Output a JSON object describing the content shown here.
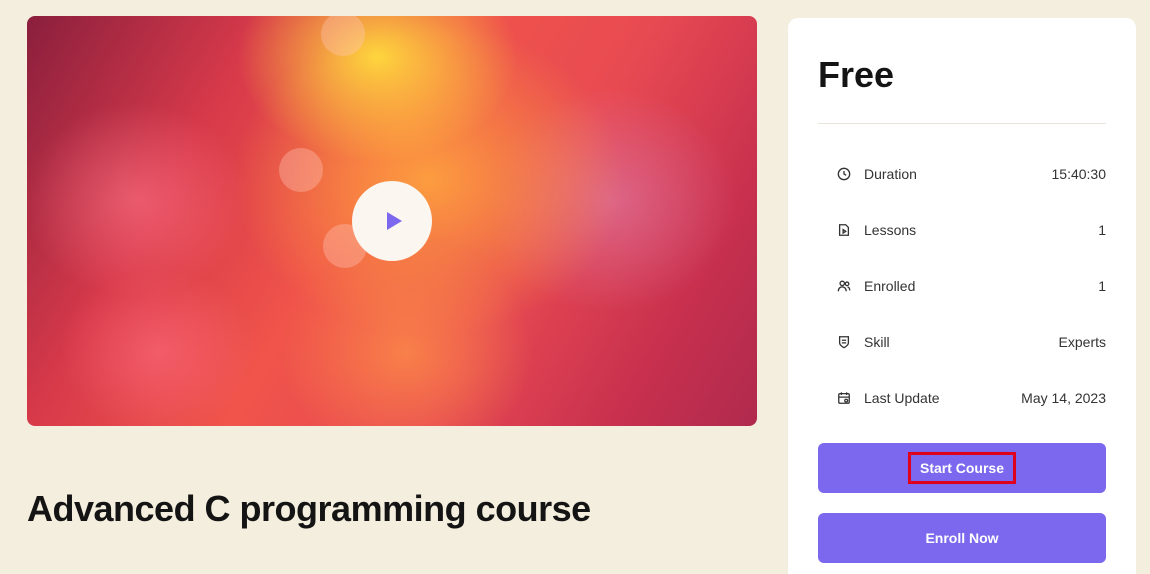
{
  "course": {
    "title": "Advanced C programming course"
  },
  "video": {
    "play_icon": "play-icon",
    "accent_color": "#7b68ee"
  },
  "sidebar": {
    "price": "Free",
    "info": [
      {
        "icon": "clock-icon",
        "label": "Duration",
        "value": "15:40:30"
      },
      {
        "icon": "lesson-file-icon",
        "label": "Lessons",
        "value": "1"
      },
      {
        "icon": "users-icon",
        "label": "Enrolled",
        "value": "1"
      },
      {
        "icon": "shield-icon",
        "label": "Skill",
        "value": "Experts"
      },
      {
        "icon": "calendar-icon",
        "label": "Last Update",
        "value": "May 14, 2023"
      }
    ],
    "start_label": "Start Course",
    "enroll_label": "Enroll Now",
    "button_color": "#7b68ee",
    "highlight_color": "#e0001b"
  }
}
